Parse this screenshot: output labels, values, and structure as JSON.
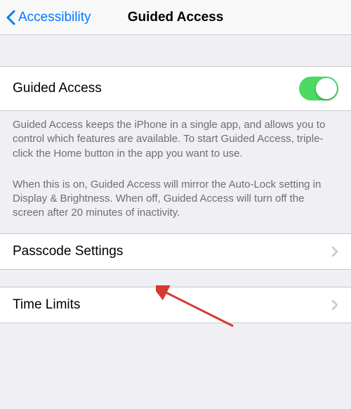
{
  "nav": {
    "back_label": "Accessibility",
    "title": "Guided Access"
  },
  "toggle_row": {
    "label": "Guided Access",
    "on": true
  },
  "footer1": "Guided Access keeps the iPhone in a single app, and allows you to control which features are available. To start Guided Access, triple-click the Home button in the app you want to use.",
  "footer2": "When this is on, Guided Access will mirror the Auto-Lock setting in Display & Brightness. When off, Guided Access will turn off the screen after 20 minutes of inactivity.",
  "passcode_row": {
    "label": "Passcode Settings"
  },
  "time_limits_row": {
    "label": "Time Limits"
  },
  "colors": {
    "link": "#007aff",
    "toggle_on": "#4cd964",
    "annotation": "#d43a2f"
  }
}
